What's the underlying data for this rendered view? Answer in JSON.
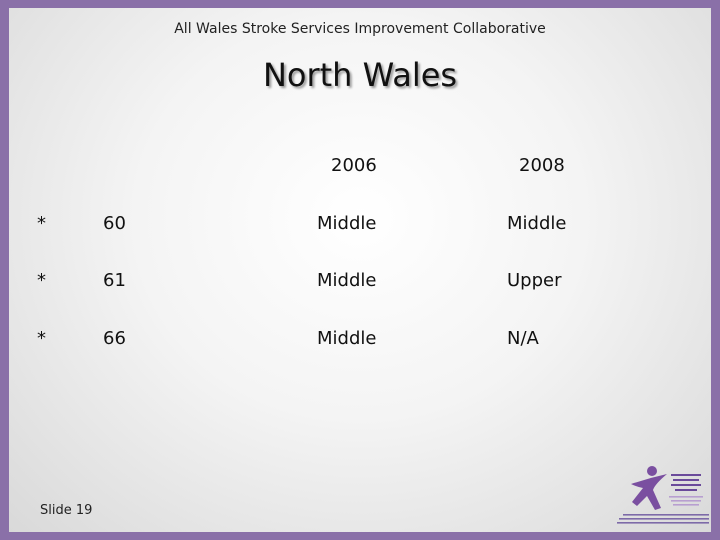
{
  "header": {
    "text": "All Wales Stroke Services Improvement Collaborative"
  },
  "title": "North Wales",
  "table": {
    "columns": [
      "2006",
      "2008"
    ],
    "rows": [
      {
        "marker": "*",
        "value": "60",
        "y2006": "Middle",
        "y2008": "Middle"
      },
      {
        "marker": "*",
        "value": "61",
        "y2006": "Middle",
        "y2008": "Upper"
      },
      {
        "marker": "*",
        "value": "66",
        "y2006": "Middle",
        "y2008": "N/A"
      }
    ]
  },
  "footer": {
    "slide_number": "Slide 19"
  },
  "logo": {
    "icon": "star-person-icon",
    "color": "#7a4fa0"
  }
}
